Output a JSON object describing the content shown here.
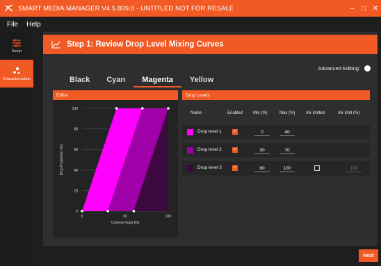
{
  "app": {
    "title": "SMART MEDIA MANAGER V4.5.809.0 - UNTITLED NOT FOR RESALE",
    "controls": {
      "minimize": "–",
      "maximize": "□",
      "close": "✕"
    }
  },
  "menu": {
    "items": [
      "File",
      "Help"
    ]
  },
  "sidebar": {
    "items": [
      {
        "label": "Setup",
        "icon": "sliders-icon"
      },
      {
        "label": "Characterization",
        "icon": "dots-icon",
        "active": true
      }
    ]
  },
  "step": {
    "title": "Step 1: Review Drop Level Mixing Curves",
    "icon": "chart-line-icon"
  },
  "advanced": {
    "label": "Advanced Editing:"
  },
  "tabs": [
    {
      "label": "Black"
    },
    {
      "label": "Cyan"
    },
    {
      "label": "Magenta",
      "active": true
    },
    {
      "label": "Yellow"
    }
  ],
  "editor": {
    "header": "Editor"
  },
  "drop_levels": {
    "header": "Drop Levels",
    "columns": {
      "name": "Name",
      "enabled": "Enabled",
      "min": "Min (%)",
      "max": "Max (%)",
      "ink_limited": "Ink limited",
      "ink_limit": "Ink limit (%)"
    },
    "rows": [
      {
        "name": "Drop level 1",
        "color": "#ff00ff",
        "enabled": true,
        "min": "0",
        "max": "40"
      },
      {
        "name": "Drop level 2",
        "color": "#a000a8",
        "enabled": true,
        "min": "30",
        "max": "70"
      },
      {
        "name": "Drop level 3",
        "color": "#3d0840",
        "enabled": true,
        "min": "60",
        "max": "100",
        "ink_limited": false,
        "ink_limit": "100"
      }
    ]
  },
  "next": {
    "label": "Next"
  },
  "chart_data": {
    "type": "area",
    "xlabel": "Contone Input [%]",
    "ylabel": "Drop Proportion (%)",
    "xlim": [
      0,
      100
    ],
    "ylim": [
      0,
      100
    ],
    "x_ticks": [
      "0",
      "50",
      "100"
    ],
    "y_ticks": [
      "0",
      "20",
      "40",
      "60",
      "80",
      "100"
    ],
    "series": [
      {
        "color": "#ff00ff",
        "points": [
          [
            0,
            0
          ],
          [
            40,
            100
          ]
        ]
      },
      {
        "color": "#a000a8",
        "points": [
          [
            30,
            0
          ],
          [
            70,
            100
          ]
        ]
      },
      {
        "color": "#3d0840",
        "points": [
          [
            60,
            0
          ],
          [
            100,
            100
          ]
        ]
      }
    ]
  }
}
